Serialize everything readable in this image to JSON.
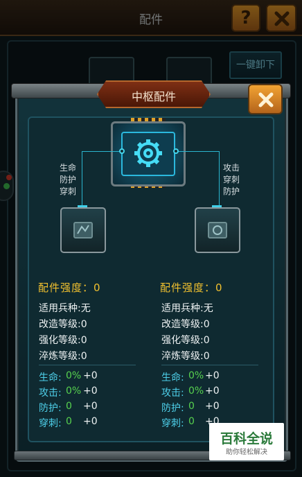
{
  "background": {
    "title": "配件",
    "help_label": "?",
    "unload_all_label": "一键卸下"
  },
  "modal": {
    "title": "中枢配件",
    "left_attrs": [
      "生命",
      "防护",
      "穿刺"
    ],
    "right_attrs": [
      "攻击",
      "穿刺",
      "防护"
    ]
  },
  "columns": [
    {
      "strength_label": "配件强度：",
      "strength_value": "0",
      "info": [
        {
          "k": "适用兵种:",
          "v": "无"
        },
        {
          "k": "改造等级:",
          "v": "0"
        },
        {
          "k": "强化等级:",
          "v": "0"
        },
        {
          "k": "淬炼等级:",
          "v": "0"
        }
      ],
      "attrs": [
        {
          "k": "生命:",
          "pct": "0%",
          "plus": "+0"
        },
        {
          "k": "攻击:",
          "pct": "0%",
          "plus": "+0"
        },
        {
          "k": "防护:",
          "pct": "0",
          "plus": "+0"
        },
        {
          "k": "穿刺:",
          "pct": "0",
          "plus": "+0"
        }
      ]
    },
    {
      "strength_label": "配件强度：",
      "strength_value": "0",
      "info": [
        {
          "k": "适用兵种:",
          "v": "无"
        },
        {
          "k": "改造等级:",
          "v": "0"
        },
        {
          "k": "强化等级:",
          "v": "0"
        },
        {
          "k": "淬炼等级:",
          "v": "0"
        }
      ],
      "attrs": [
        {
          "k": "生命:",
          "pct": "0%",
          "plus": "+0"
        },
        {
          "k": "攻击:",
          "pct": "0%",
          "plus": "+0"
        },
        {
          "k": "防护:",
          "pct": "0",
          "plus": "+0"
        },
        {
          "k": "穿刺:",
          "pct": "0",
          "plus": "+0"
        }
      ]
    }
  ],
  "watermark": {
    "title": "百科全说",
    "subtitle": "助你轻松解决"
  },
  "colors": {
    "accent_cyan": "#4ed0ea",
    "strength_yellow": "#f1c02f",
    "percent_green": "#57d24f",
    "close_orange": "#f2a333"
  },
  "icons": [
    "gear-icon",
    "close-icon",
    "help-icon",
    "part-icon"
  ]
}
